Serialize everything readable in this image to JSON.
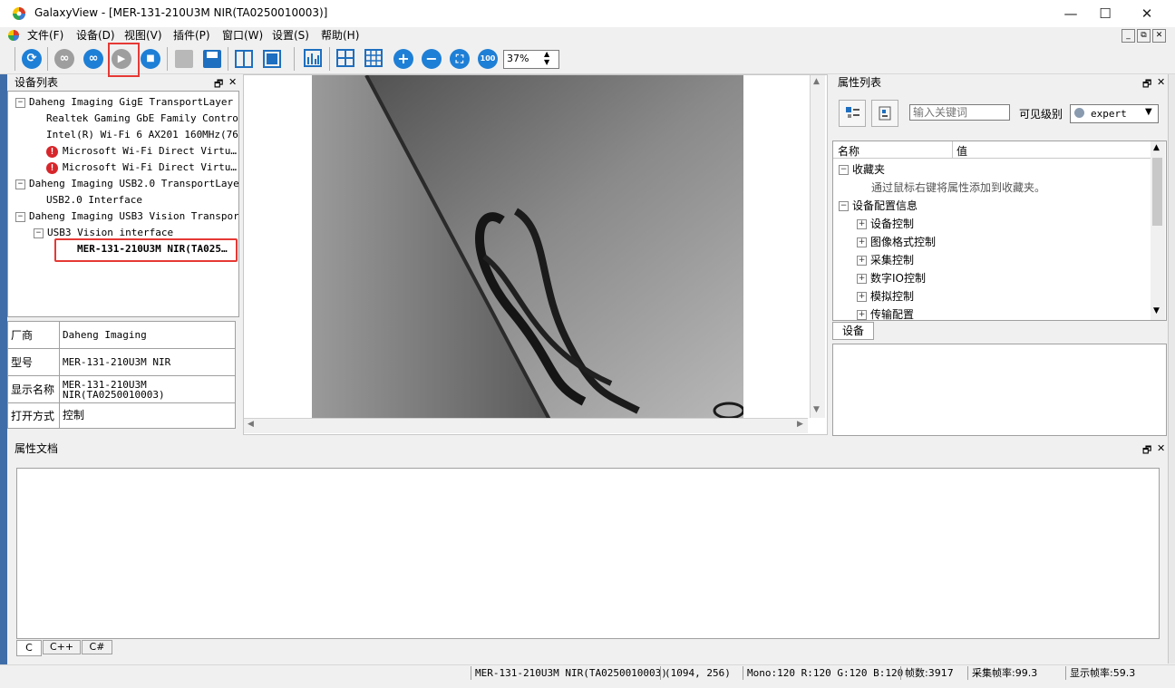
{
  "window": {
    "title": "GalaxyView - [MER-131-210U3M NIR(TA0250010003)]",
    "minimize": "—",
    "maximize": "☐",
    "close": "✕"
  },
  "menu": {
    "items": [
      "文件(F)",
      "设备(D)",
      "视图(V)",
      "插件(P)",
      "窗口(W)",
      "设置(S)",
      "帮助(H)"
    ],
    "mdi": [
      "_",
      "⧉",
      "✕"
    ]
  },
  "toolbar": {
    "buttons": [
      {
        "icon": "refresh-icon"
      },
      {
        "icon": "link-icon"
      },
      {
        "icon": "link-add-icon"
      },
      {
        "icon": "play-icon"
      },
      {
        "icon": "stop-icon"
      },
      {
        "icon": "folder-icon"
      },
      {
        "icon": "save-icon"
      },
      {
        "icon": "split-view-icon"
      },
      {
        "icon": "window-icon"
      },
      {
        "icon": "histogram-icon"
      },
      {
        "icon": "grid-4-icon"
      },
      {
        "icon": "grid-9-icon"
      },
      {
        "icon": "zoom-in-icon"
      },
      {
        "icon": "zoom-out-icon"
      },
      {
        "icon": "fit-icon"
      },
      {
        "icon": "actual-size-icon"
      }
    ],
    "actual_size_label": "100",
    "zoom_value": "37%",
    "highlight_color": "#e53935"
  },
  "device_list": {
    "title": "设备列表",
    "float": "🗗",
    "close": "✕",
    "tree": [
      {
        "label": "Daheng Imaging GigE TransportLayer",
        "level": 0,
        "expander": "−"
      },
      {
        "label": "Realtek Gaming GbE Family Contro…",
        "level": 1
      },
      {
        "label": "Intel(R) Wi-Fi 6 AX201 160MHz(76…",
        "level": 1
      },
      {
        "label": "Microsoft Wi-Fi Direct Virtu…",
        "level": 1,
        "error": "!"
      },
      {
        "label": "Microsoft Wi-Fi Direct Virtu…",
        "level": 1,
        "error": "!"
      },
      {
        "label": "Daheng Imaging USB2.0 TransportLayer",
        "level": 0,
        "expander": "−"
      },
      {
        "label": "USB2.0 Interface",
        "level": 1
      },
      {
        "label": "Daheng Imaging USB3 Vision Transpor…",
        "level": 0,
        "expander": "−"
      },
      {
        "label": "USB3 Vision interface",
        "level": 1,
        "expander": "−"
      },
      {
        "label": "MER-131-210U3M NIR(TA025…",
        "level": 2,
        "selected": true
      }
    ]
  },
  "device_info": [
    {
      "key": "厂商",
      "value": "Daheng Imaging"
    },
    {
      "key": "型号",
      "value": "MER-131-210U3M NIR"
    },
    {
      "key": "显示名称",
      "value": "MER-131-210U3M\nNIR(TA0250010003)"
    },
    {
      "key": "打开方式",
      "value": "控制"
    }
  ],
  "properties": {
    "title": "属性列表",
    "float": "🗗",
    "close": "✕",
    "search_placeholder": "输入关键词",
    "visibility_label": "可见级别",
    "visibility_value": "expert",
    "col_name": "名称",
    "col_value": "值",
    "tree": [
      {
        "label": "收藏夹",
        "level": 0,
        "expander": "−"
      },
      {
        "label": "通过鼠标右键将属性添加到收藏夹。",
        "level": 1,
        "hint": true
      },
      {
        "label": "设备配置信息",
        "level": 0,
        "expander": "−"
      },
      {
        "label": "设备控制",
        "level": 1,
        "expander": "+"
      },
      {
        "label": "图像格式控制",
        "level": 1,
        "expander": "+"
      },
      {
        "label": "采集控制",
        "level": 1,
        "expander": "+"
      },
      {
        "label": "数字IO控制",
        "level": 1,
        "expander": "+"
      },
      {
        "label": "模拟控制",
        "level": 1,
        "expander": "+"
      },
      {
        "label": "传输配置",
        "level": 1,
        "expander": "+"
      }
    ],
    "tab": "设备"
  },
  "docs": {
    "title": "属性文档",
    "float": "🗗",
    "close": "✕",
    "tabs": [
      "C",
      "C++",
      "C#"
    ]
  },
  "status": {
    "device": "MER-131-210U3M NIR(TA0250010003)",
    "coords": "(1094, 256)",
    "pixel": "Mono:120  R:120 G:120 B:120",
    "frames": "帧数:3917",
    "acq_rate": "采集帧率:99.3",
    "disp_rate": "显示帧率:59.3"
  }
}
